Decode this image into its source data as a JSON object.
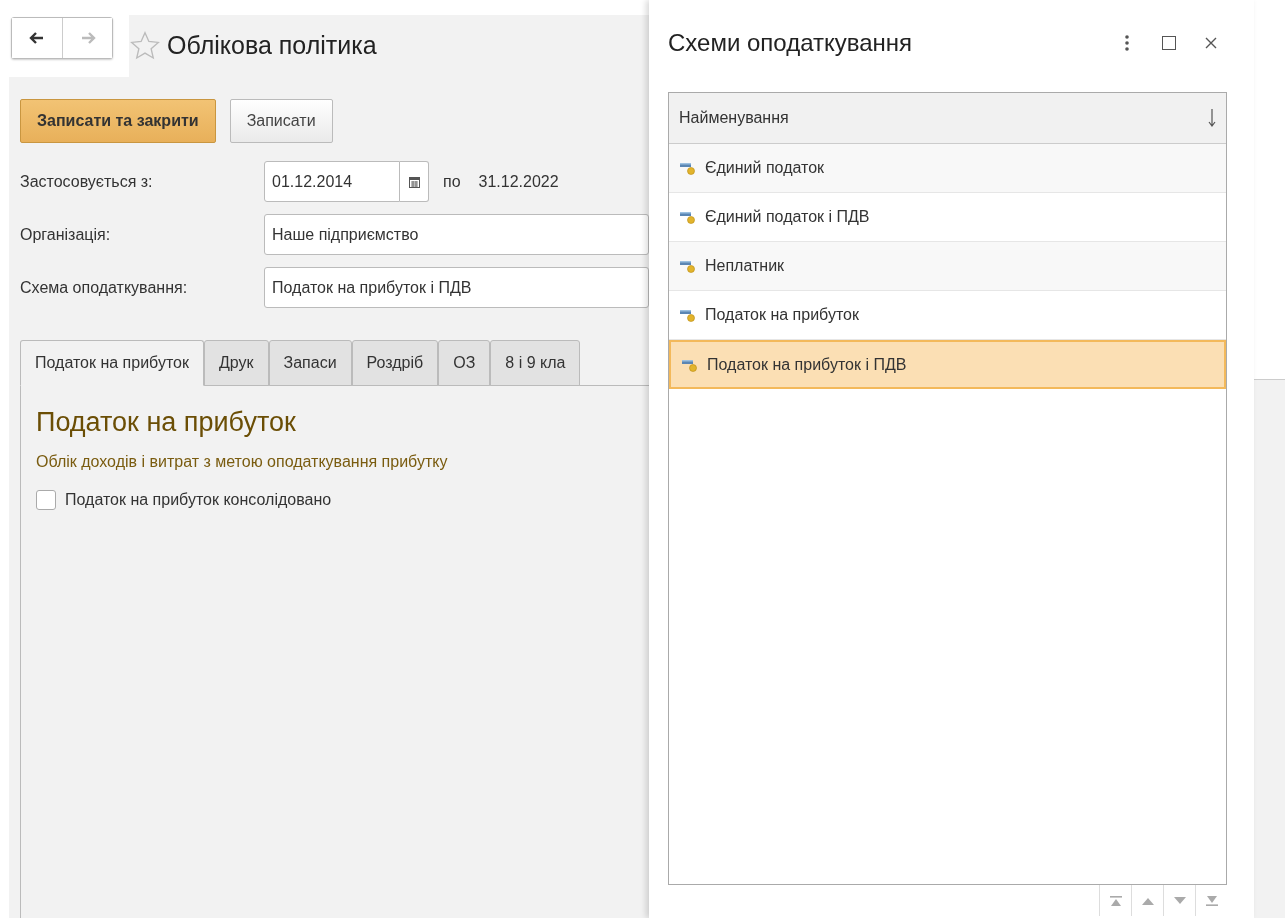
{
  "form": {
    "nav": [
      {
        "kind": "back",
        "disabled": false
      },
      {
        "kind": "forward",
        "disabled": true
      }
    ],
    "favorite": false,
    "title": "Облікова політика",
    "buttons": [
      {
        "label": "Записати та закрити",
        "kind": "primary"
      },
      {
        "label": "Записати",
        "kind": "secondary"
      }
    ],
    "fields": [
      {
        "label": "Застосовується з:",
        "value": "01.12.2014",
        "kind": "date",
        "to_label": "по",
        "to_value": "31.12.2022"
      },
      {
        "label": "Організація:",
        "value": "Наше підприємство",
        "kind": "text"
      },
      {
        "label": "Схема оподаткування:",
        "value": "Податок на прибуток і ПДВ",
        "kind": "text"
      }
    ],
    "tabs": [
      {
        "label": "Податок на прибуток",
        "selected": true
      },
      {
        "label": "Друк",
        "selected": false
      },
      {
        "label": "Запаси",
        "selected": false
      },
      {
        "label": "Роздріб",
        "selected": false
      },
      {
        "label": "ОЗ",
        "selected": false
      },
      {
        "label": "8 і 9 кла",
        "selected": false
      }
    ],
    "section": {
      "heading": "Податок на прибуток",
      "subtitle": "Облік доходів і витрат з метою оподаткування прибутку",
      "checkbox": {
        "label": "Податок на прибуток консолідовано",
        "checked": false
      }
    }
  },
  "dialog": {
    "title": "Схеми оподаткування",
    "column": "Найменування",
    "rows": [
      {
        "label": "Єдиний податок",
        "selected": false
      },
      {
        "label": "Єдиний податок і ПДВ",
        "selected": false
      },
      {
        "label": "Неплатник",
        "selected": false
      },
      {
        "label": "Податок на прибуток",
        "selected": false
      },
      {
        "label": "Податок на прибуток і ПДВ",
        "selected": true
      }
    ]
  }
}
